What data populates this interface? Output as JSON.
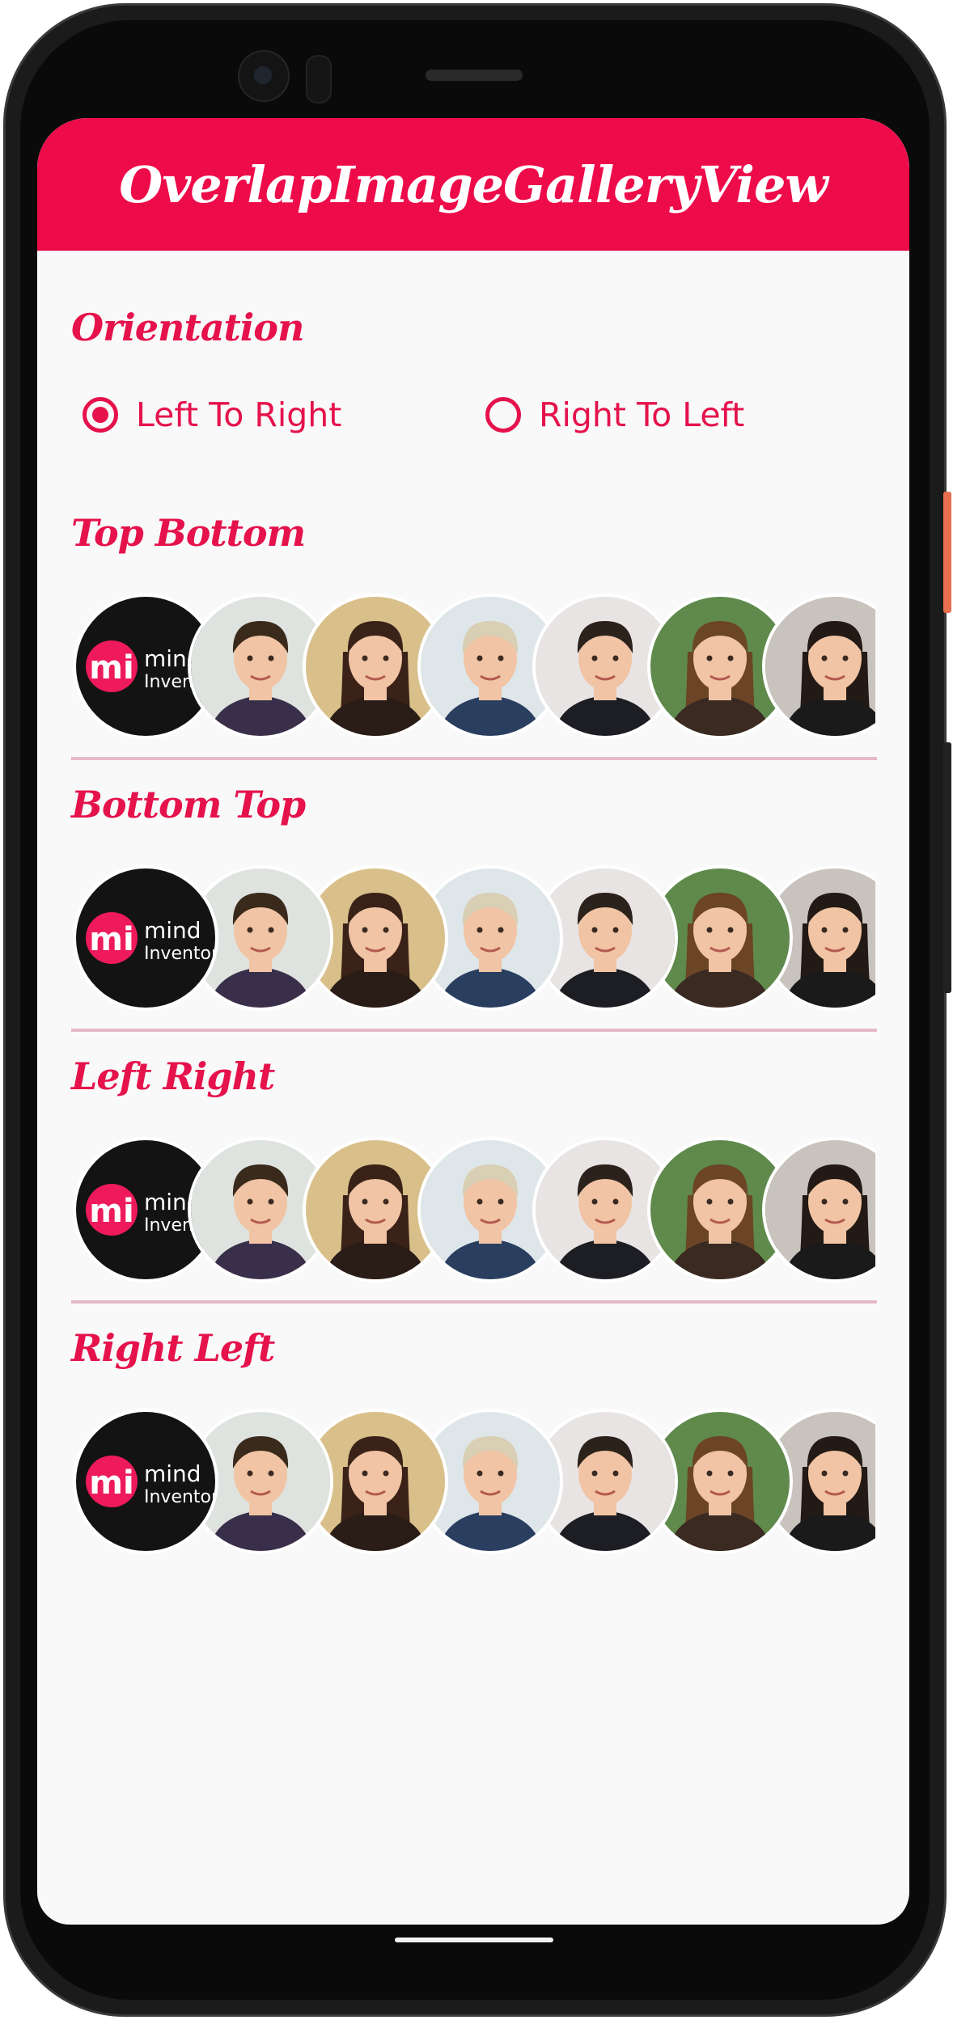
{
  "app_title": "OverlapImageGalleryView",
  "colors": {
    "accent": "#ee0b4a",
    "text_accent": "#e5124c",
    "divider": "#e5b9c8",
    "background": "#f9f9f9"
  },
  "orientation": {
    "label": "Orientation",
    "options": [
      {
        "label": "Left To Right",
        "selected": true
      },
      {
        "label": "Right To Left",
        "selected": false
      }
    ]
  },
  "galleries": [
    {
      "title": "Top Bottom"
    },
    {
      "title": "Bottom Top"
    },
    {
      "title": "Left Right"
    },
    {
      "title": "Right Left"
    }
  ],
  "logo": {
    "mark": "mi",
    "text_line1": "mind",
    "text_line2": "Inventory"
  },
  "avatars": [
    {
      "kind": "logo"
    },
    {
      "kind": "photo",
      "name": "man-short-hair"
    },
    {
      "kind": "photo",
      "name": "woman-long-brown-hair"
    },
    {
      "kind": "photo",
      "name": "woman-short-blonde-hair"
    },
    {
      "kind": "photo",
      "name": "man-slick-hair"
    },
    {
      "kind": "photo",
      "name": "woman-curly-hair"
    },
    {
      "kind": "photo",
      "name": "woman-dark-hair"
    }
  ]
}
